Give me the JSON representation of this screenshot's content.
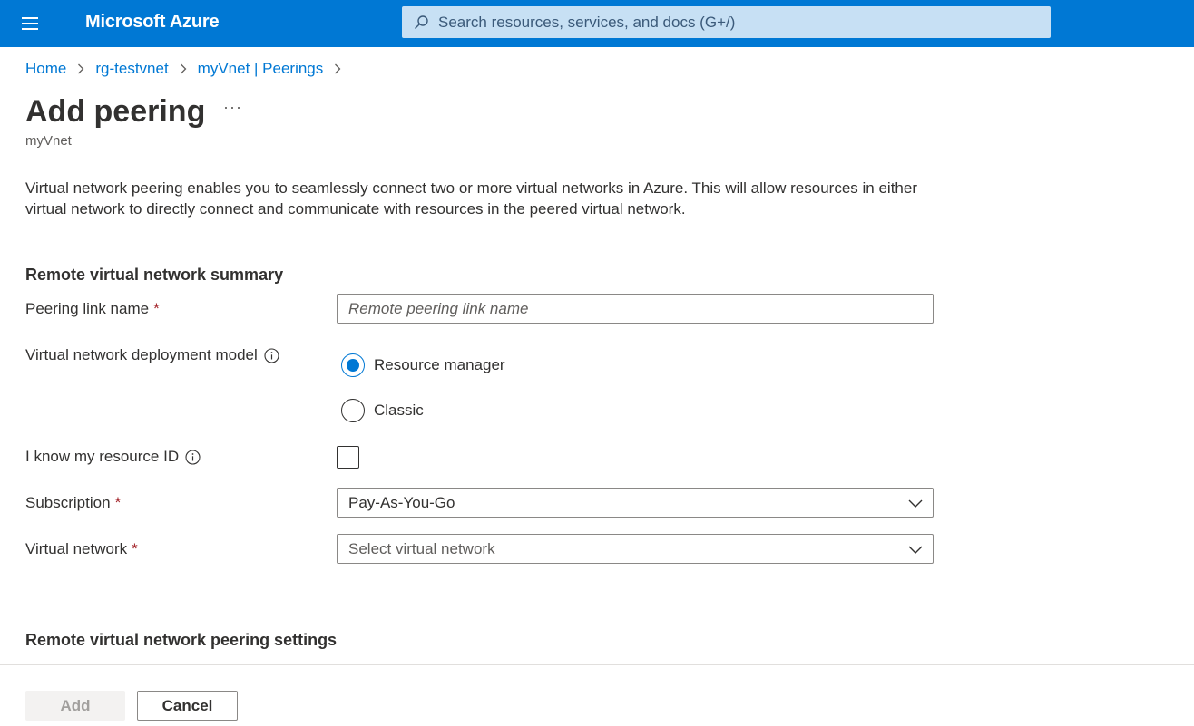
{
  "header": {
    "brand": "Microsoft Azure",
    "search_placeholder": "Search resources, services, and docs (G+/)"
  },
  "breadcrumb": [
    "Home",
    "rg-testvnet",
    "myVnet | Peerings"
  ],
  "page": {
    "title": "Add peering",
    "more": "···",
    "subtitle": "myVnet",
    "description": "Virtual network peering enables you to seamlessly connect two or more virtual networks in Azure. This will allow resources in either virtual network to directly connect and communicate with resources in the peered virtual network."
  },
  "remote_summary": {
    "section_title": "Remote virtual network summary",
    "peering_link_label": "Peering link name",
    "peering_link_placeholder": "Remote peering link name",
    "deployment_label": "Virtual network deployment model",
    "deployment_options": [
      "Resource manager",
      "Classic"
    ],
    "deployment_selected": "Resource manager",
    "resource_id_label": "I know my resource ID",
    "resource_id_checked": false,
    "subscription_label": "Subscription",
    "subscription_value": "Pay-As-You-Go",
    "vnet_label": "Virtual network",
    "vnet_placeholder": "Select virtual network",
    "required_marker": "*"
  },
  "remote_settings": {
    "section_title": "Remote virtual network peering settings"
  },
  "footer": {
    "add_label": "Add",
    "cancel_label": "Cancel"
  },
  "colors": {
    "accent": "#0078d4",
    "required": "#a4262c"
  }
}
